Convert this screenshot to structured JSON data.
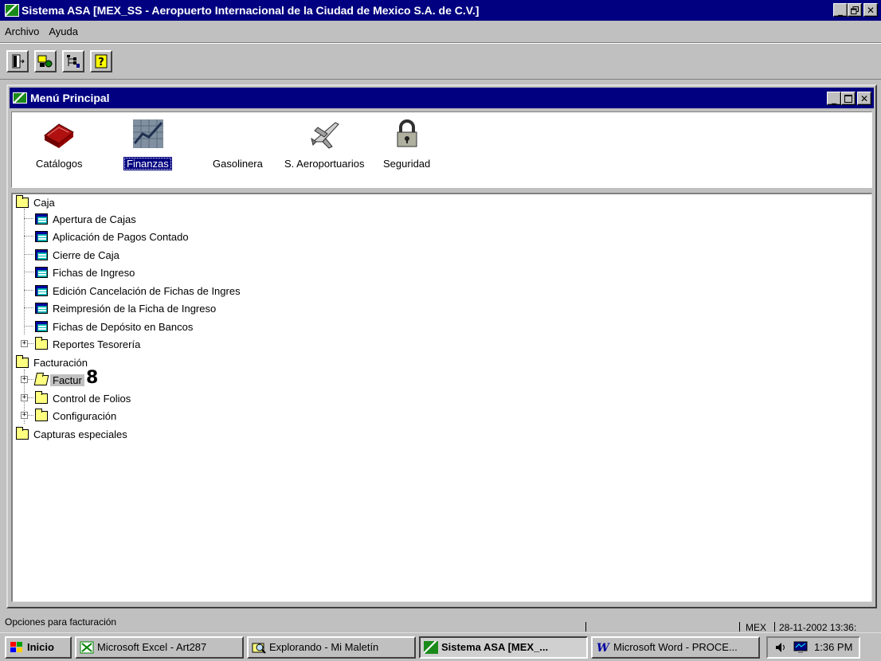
{
  "window": {
    "title": "Sistema ASA [MEX_SS - Aeropuerto Internacional de la Ciudad de Mexico S.A. de C.V.]",
    "minimize_label": "_",
    "restore_label": "▫",
    "close_label": "✕"
  },
  "menu": {
    "items": [
      "Archivo",
      "Ayuda"
    ]
  },
  "toolbar": {
    "buttons": [
      "exit-icon",
      "connection-icon",
      "tree-icon",
      "help-icon"
    ]
  },
  "main_menu": {
    "title": "Menú Principal",
    "modules": [
      {
        "label": "Catálogos",
        "icon": "books-icon"
      },
      {
        "label": "Finanzas",
        "icon": "finance-chart-icon",
        "selected": true
      },
      {
        "label": "Gasolinera",
        "icon": "gas-station-icon"
      },
      {
        "label": "S. Aeroportuarios",
        "icon": "airplane-icon"
      },
      {
        "label": "Seguridad",
        "icon": "padlock-icon"
      }
    ]
  },
  "tree": {
    "caja": "Caja",
    "caja_items": [
      "Apertura de Cajas",
      "Aplicación de Pagos Contado",
      "Cierre de Caja",
      "Fichas de Ingreso",
      "Edición Cancelación de Fichas de Ingres",
      "Reimpresión de la Ficha de Ingreso",
      "Fichas de Depósito en Bancos"
    ],
    "reportes": "Reportes Tesorería",
    "facturacion": "Facturación",
    "facturacion_items": [
      "Factur",
      "Control de Folios",
      "Configuración"
    ],
    "capturas": "Capturas especiales",
    "cursor_marker": "8"
  },
  "status": {
    "message": "Opciones para facturación",
    "user_code": "MEX",
    "datetime": "28-11-2002 13:36:"
  },
  "taskbar": {
    "start": "Inicio",
    "tasks": [
      "Microsoft Excel - Art287",
      "Explorando - Mi Maletín",
      "Sistema ASA [MEX_...",
      "Microsoft Word - PROCE..."
    ],
    "clock": "1:36 PM"
  },
  "colors": {
    "titlebar": "#000080",
    "face": "#c0c0c0",
    "folder": "#ffff80"
  }
}
